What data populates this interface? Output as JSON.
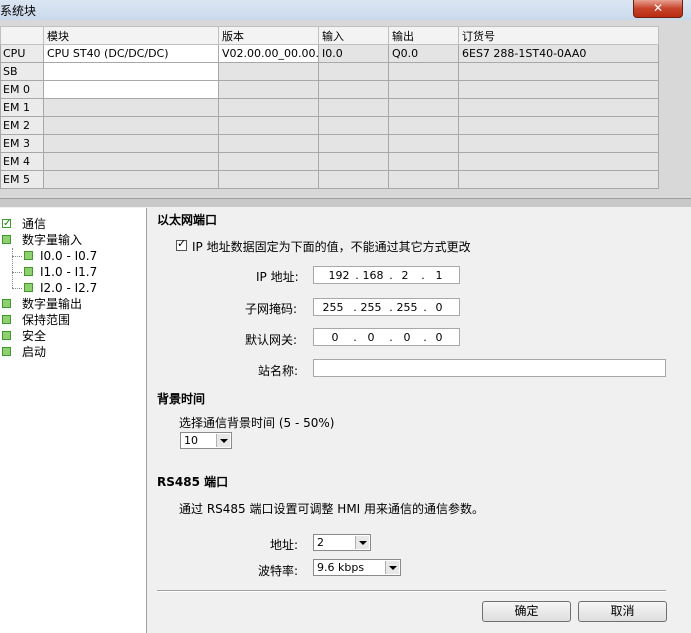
{
  "window": {
    "title": "系统块",
    "close_label": "✕"
  },
  "modules": {
    "headers": [
      "",
      "模块",
      "版本",
      "输入",
      "输出",
      "订货号"
    ],
    "rows": [
      {
        "slot": "CPU",
        "module": "CPU ST40 (DC/DC/DC)",
        "version": "V02.00.00_00.00...",
        "input": "I0.0",
        "output": "Q0.0",
        "order": "6ES7 288-1ST40-0AA0"
      },
      {
        "slot": "SB",
        "module": "",
        "version": "",
        "input": "",
        "output": "",
        "order": ""
      },
      {
        "slot": "EM 0",
        "module": "",
        "version": "",
        "input": "",
        "output": "",
        "order": ""
      },
      {
        "slot": "EM 1",
        "module": "",
        "version": "",
        "input": "",
        "output": "",
        "order": ""
      },
      {
        "slot": "EM 2",
        "module": "",
        "version": "",
        "input": "",
        "output": "",
        "order": ""
      },
      {
        "slot": "EM 3",
        "module": "",
        "version": "",
        "input": "",
        "output": "",
        "order": ""
      },
      {
        "slot": "EM 4",
        "module": "",
        "version": "",
        "input": "",
        "output": "",
        "order": ""
      },
      {
        "slot": "EM 5",
        "module": "",
        "version": "",
        "input": "",
        "output": "",
        "order": ""
      }
    ]
  },
  "tree": {
    "items": [
      {
        "label": "通信"
      },
      {
        "label": "数字量输入"
      },
      {
        "label": "I0.0 - I0.7"
      },
      {
        "label": "I1.0 - I1.7"
      },
      {
        "label": "I2.0 - I2.7"
      },
      {
        "label": "数字量输出"
      },
      {
        "label": "保持范围"
      },
      {
        "label": "安全"
      },
      {
        "label": "启动"
      }
    ]
  },
  "ethernet": {
    "title": "以太网端口",
    "fixed_ip_label": "IP 地址数据固定为下面的值，不能通过其它方式更改",
    "ip_label": "IP 地址:",
    "ip": [
      "192",
      "168",
      "2",
      "1"
    ],
    "subnet_label": "子网掩码:",
    "subnet": [
      "255",
      "255",
      "255",
      "0"
    ],
    "gateway_label": "默认网关:",
    "gateway": [
      "0",
      "0",
      "0",
      "0"
    ],
    "station_label": "站名称:",
    "station_value": ""
  },
  "background": {
    "title": "背景时间",
    "select_label": "选择通信背景时间 (5 - 50%)",
    "value": "10"
  },
  "rs485": {
    "title": "RS485 端口",
    "description": "通过 RS485 端口设置可调整 HMI 用来通信的通信参数。",
    "address_label": "地址:",
    "address_value": "2",
    "baud_label": "波特率:",
    "baud_value": "9.6 kbps"
  },
  "buttons": {
    "ok": "确定",
    "cancel": "取消"
  }
}
